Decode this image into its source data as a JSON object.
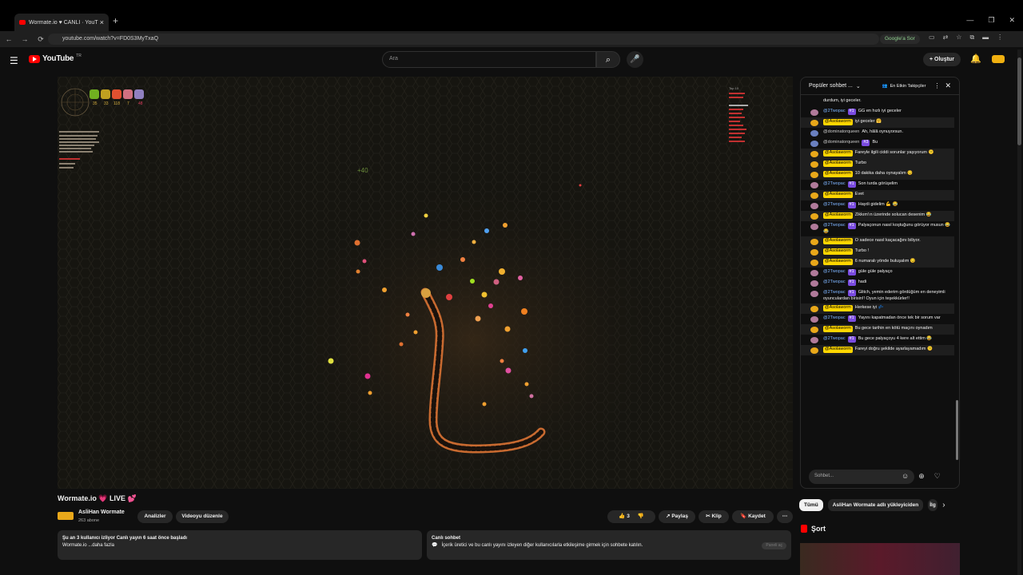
{
  "browser": {
    "tab_title": "Wormate.io ♥ CANLI · YouT",
    "url": "youtube.com/watch?v=FD0S3MyTxaQ",
    "google_button": "Google'a Sor"
  },
  "header": {
    "logo_text": "YouTube",
    "region": "TR",
    "search_placeholder": "Ara",
    "create_label": "Oluştur"
  },
  "video": {
    "score_popup": "+40",
    "hud_stats": [
      "35",
      "33",
      "118",
      "7",
      "48"
    ],
    "leaderboard_title": "Top 10"
  },
  "below": {
    "title": "Wormate.io 💗 LIVE 💕",
    "channel_name": "AsliHan Wormate",
    "subscribers": "263 abone",
    "btn_analytics": "Analizler",
    "btn_edit": "Videoyu düzenle",
    "likes": "3",
    "btn_share": "Paylaş",
    "btn_clip": "Klip",
    "btn_save": "Kaydet",
    "desc_line1": "Şu an 3 kullanıcı izliyor  Canlı yayın 6 saat önce başladı",
    "desc_line2": "Wormate.io  ...daha fazla",
    "livechat_title": "Canlı sohbet",
    "livechat_text": "İçerik üretici ve bu canlı yayını izleyen diğer kullanıcılarla etkileşime girmek için sohbete katılın.",
    "livechat_btn": "Paneli aç"
  },
  "chat": {
    "header_title": "Popüler sohbet ...",
    "filter_label": "En Etkin Takipçiler",
    "input_placeholder": "Sohbet...",
    "messages": [
      {
        "name": "",
        "kind": "cont",
        "badge": "",
        "text": "durdum, iyi geceler."
      },
      {
        "name": "@2Twopac",
        "kind": "blue",
        "badge": "#1",
        "text": "GG en hızlı iyi geceler"
      },
      {
        "name": "@Asolaworm",
        "kind": "yellow",
        "badge": "",
        "text": "iyi geceler 🤗"
      },
      {
        "name": "@dominatorqueen",
        "kind": "grey",
        "badge": "",
        "text": "Ah, hâlâ oynuyorsun."
      },
      {
        "name": "@dominatorqueen",
        "kind": "grey",
        "badge": "#3",
        "text": "Bu"
      },
      {
        "name": "@Asolaworm",
        "kind": "yellow",
        "badge": "",
        "text": "Fareyle ilgili ciddi sorunlar yaşıyorum 😕"
      },
      {
        "name": "@Asolaworm",
        "kind": "yellow",
        "badge": "",
        "text": "Turbo"
      },
      {
        "name": "@Asolaworm",
        "kind": "yellow",
        "badge": "",
        "text": "10 dakika daha oynayalım 😏"
      },
      {
        "name": "@2Twopac",
        "kind": "blue",
        "badge": "#1",
        "text": "Son turda görüşelim"
      },
      {
        "name": "@Asolaworm",
        "kind": "yellow",
        "badge": "",
        "text": "Evet"
      },
      {
        "name": "@2Twopac",
        "kind": "blue",
        "badge": "#1",
        "text": "Haydi gidelim 💪 😂"
      },
      {
        "name": "@Asolaworm",
        "kind": "yellow",
        "badge": "",
        "text": "Zikkım'ın üzerinde solucan desenim 😂"
      },
      {
        "name": "@2Twopac",
        "kind": "blue",
        "badge": "#1",
        "text": "Palyaçonun nasıl koştuğunu görüyor musun 😂 😂"
      },
      {
        "name": "@Asolaworm",
        "kind": "yellow",
        "badge": "",
        "text": "O sadece nasıl kaçacağını biliyor."
      },
      {
        "name": "@Asolaworm",
        "kind": "yellow",
        "badge": "",
        "text": "Turbo !"
      },
      {
        "name": "@Asolaworm",
        "kind": "yellow",
        "badge": "",
        "text": "6 numaralı yönde buluşalım 😏"
      },
      {
        "name": "@2Twopac",
        "kind": "blue",
        "badge": "#1",
        "text": "güle güle palyaço"
      },
      {
        "name": "@2Twopac",
        "kind": "blue",
        "badge": "#1",
        "text": "hadi"
      },
      {
        "name": "@2Twopac",
        "kind": "blue",
        "badge": "#1",
        "text": "Glitch, yemin ederim gördüğüm en deneyimli oyunculardan birisin!! Oyun için teşekkürler!!"
      },
      {
        "name": "@Asolaworm",
        "kind": "yellow",
        "badge": "",
        "text": "Herkese iyi 💤"
      },
      {
        "name": "@2Twopac",
        "kind": "blue",
        "badge": "#1",
        "text": "Yayını kapatmadan önce tek bir sorum var"
      },
      {
        "name": "@Asolaworm",
        "kind": "yellow",
        "badge": "",
        "text": "Bu gece tarihin en kötü maçını oynadım"
      },
      {
        "name": "@2Twopac",
        "kind": "blue",
        "badge": "#1",
        "text": "Bu gece palyaçoyu 4 kere alt ettim 😂"
      },
      {
        "name": "@Asolaworm",
        "kind": "yellow",
        "badge": "",
        "text": "Fareyi doğru şekilde ayarlayamadım 😕"
      }
    ]
  },
  "sidebar": {
    "chips": [
      "Tümü",
      "AsliHan Wormate adlı yükleyiciden",
      "İlg"
    ],
    "shorts_label": "Şort"
  }
}
